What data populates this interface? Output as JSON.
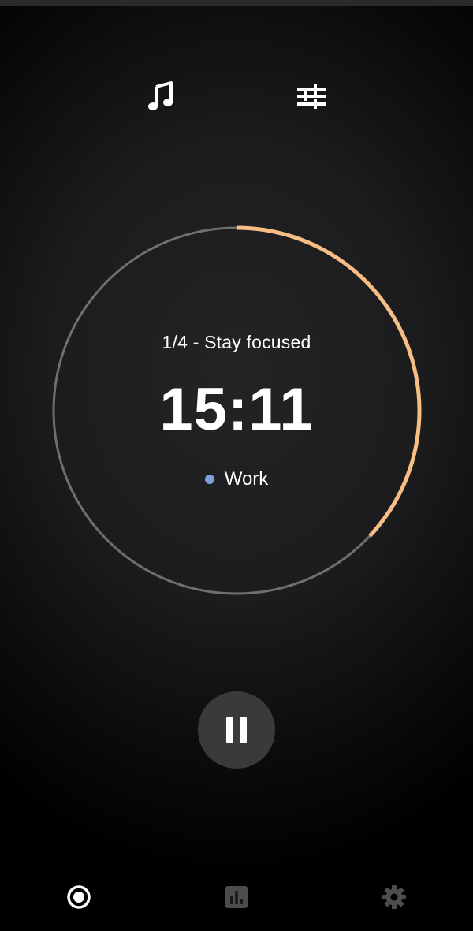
{
  "top_bar": {
    "music_icon": "music-note-icon",
    "tune_icon": "tune-sliders-icon"
  },
  "timer": {
    "session_label": "1/4 - Stay focused",
    "time": "15:11",
    "mode_label": "Work",
    "mode_color": "#7ba2dc",
    "progress_fraction": 0.37,
    "progress_color": "#f6bd84",
    "track_color": "#6f6f72"
  },
  "controls": {
    "pause_icon": "pause-icon"
  },
  "bottom_nav": {
    "items": [
      {
        "icon": "timer-record-icon",
        "active": true
      },
      {
        "icon": "stats-chart-icon",
        "active": false
      },
      {
        "icon": "gear-icon",
        "active": false
      }
    ]
  }
}
